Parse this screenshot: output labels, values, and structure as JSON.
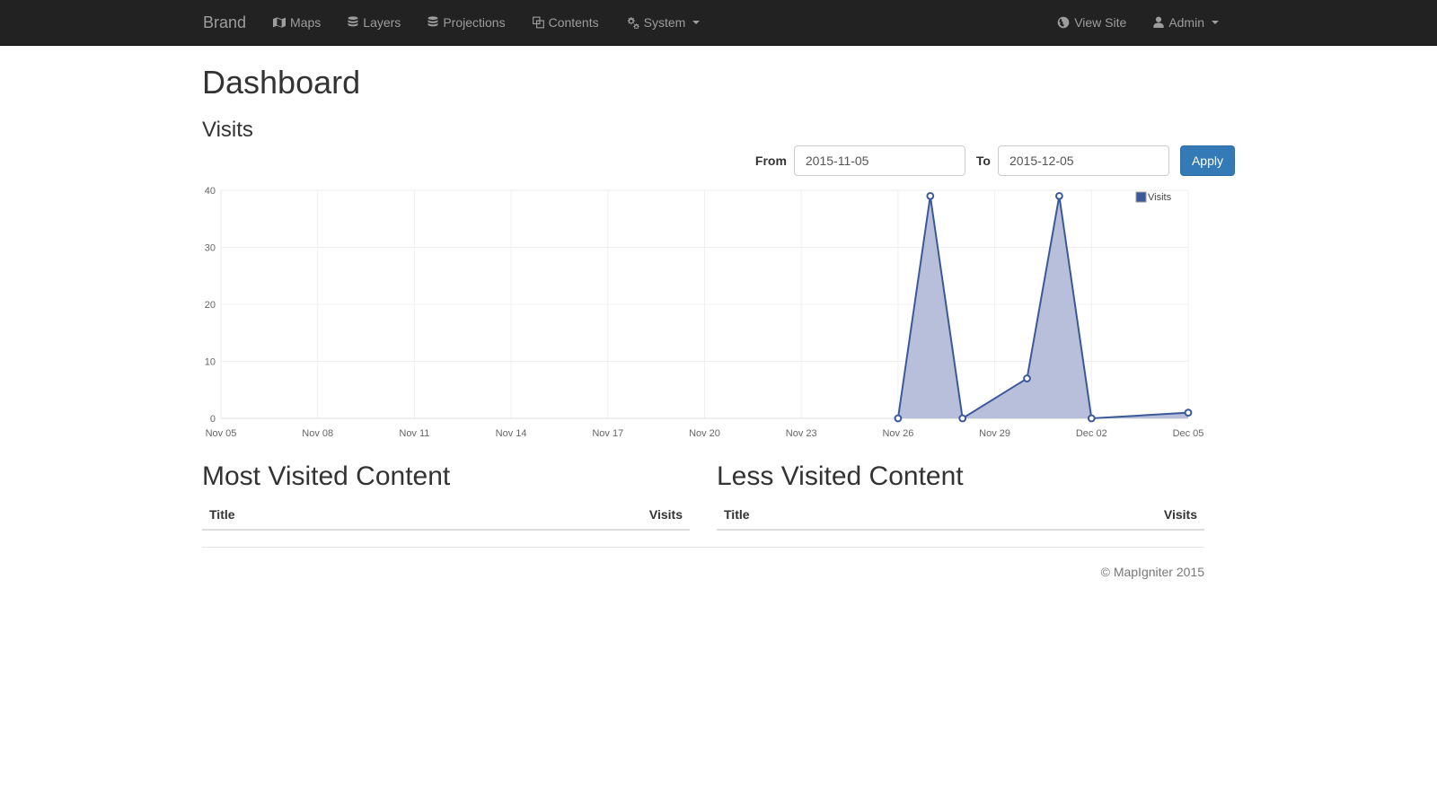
{
  "navbar": {
    "brand": "Brand",
    "left_items": [
      {
        "label": "Maps",
        "icon": "map-icon"
      },
      {
        "label": "Layers",
        "icon": "database-icon"
      },
      {
        "label": "Projections",
        "icon": "database-icon"
      },
      {
        "label": "Contents",
        "icon": "clone-icon"
      },
      {
        "label": "System",
        "icon": "cogs-icon",
        "caret": true
      }
    ],
    "right_items": [
      {
        "label": "View Site",
        "icon": "globe-icon"
      },
      {
        "label": "Admin",
        "icon": "user-icon",
        "caret": true
      }
    ],
    "bg_color": "#222222",
    "text_color": "#9d9d9d"
  },
  "page": {
    "title": "Dashboard",
    "section_title": "Visits"
  },
  "filter": {
    "from_label": "From",
    "from_value": "2015-11-05",
    "from_placeholder": "",
    "to_label": "To",
    "to_value": "2015-12-05",
    "to_placeholder": "",
    "apply_label": "Apply",
    "apply_color": "#337ab7"
  },
  "chart_data": {
    "type": "area",
    "title": "Visits",
    "xlabel": "",
    "ylabel": "",
    "ylim": [
      0,
      40
    ],
    "yticks": [
      0,
      10,
      20,
      30,
      40
    ],
    "xticks": [
      "Nov 05",
      "Nov 08",
      "Nov 11",
      "Nov 14",
      "Nov 17",
      "Nov 20",
      "Nov 23",
      "Nov 26",
      "Nov 29",
      "Dec 02",
      "Dec 05"
    ],
    "grid": true,
    "legend": {
      "position": "top-right",
      "entries": [
        "Visits"
      ]
    },
    "series": [
      {
        "name": "Visits",
        "color": "#3b5998",
        "fill_color": "#aab4d4",
        "x": [
          "Nov 26",
          "Nov 27",
          "Nov 28",
          "Nov 30",
          "Dec 01",
          "Dec 02",
          "Dec 05"
        ],
        "values": [
          0,
          39,
          0,
          7,
          39,
          0,
          1
        ]
      }
    ]
  },
  "panels": [
    {
      "title": "Most Visited Content",
      "columns": [
        "Title",
        "Visits"
      ],
      "rows": []
    },
    {
      "title": "Less Visited Content",
      "columns": [
        "Title",
        "Visits"
      ],
      "rows": []
    }
  ],
  "footer": {
    "copyright": "© MapIgniter 2015"
  }
}
